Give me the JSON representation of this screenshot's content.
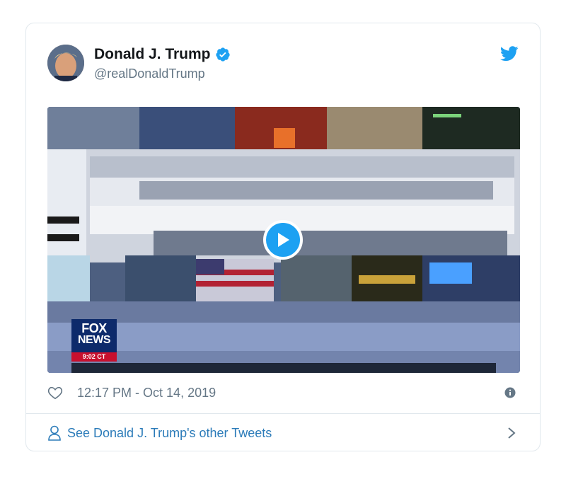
{
  "tweet": {
    "author_name": "Donald J. Trump",
    "author_handle": "@realDonaldTrump",
    "timestamp": "12:17 PM - Oct 14, 2019"
  },
  "media": {
    "watermark_line1": "FOX",
    "watermark_line2": "NEWS",
    "watermark_time": "9:02 CT"
  },
  "footer": {
    "other_tweets_label": "See Donald J. Trump's other Tweets"
  },
  "icons": [
    "verified-badge-icon",
    "twitter-bird-icon",
    "play-icon",
    "heart-icon",
    "info-icon",
    "person-icon",
    "chevron-right-icon"
  ],
  "colors": {
    "accent": "#1da1f2",
    "link": "#2b7bb9",
    "secondary_text": "#657786",
    "border": "#e1e8ed"
  }
}
